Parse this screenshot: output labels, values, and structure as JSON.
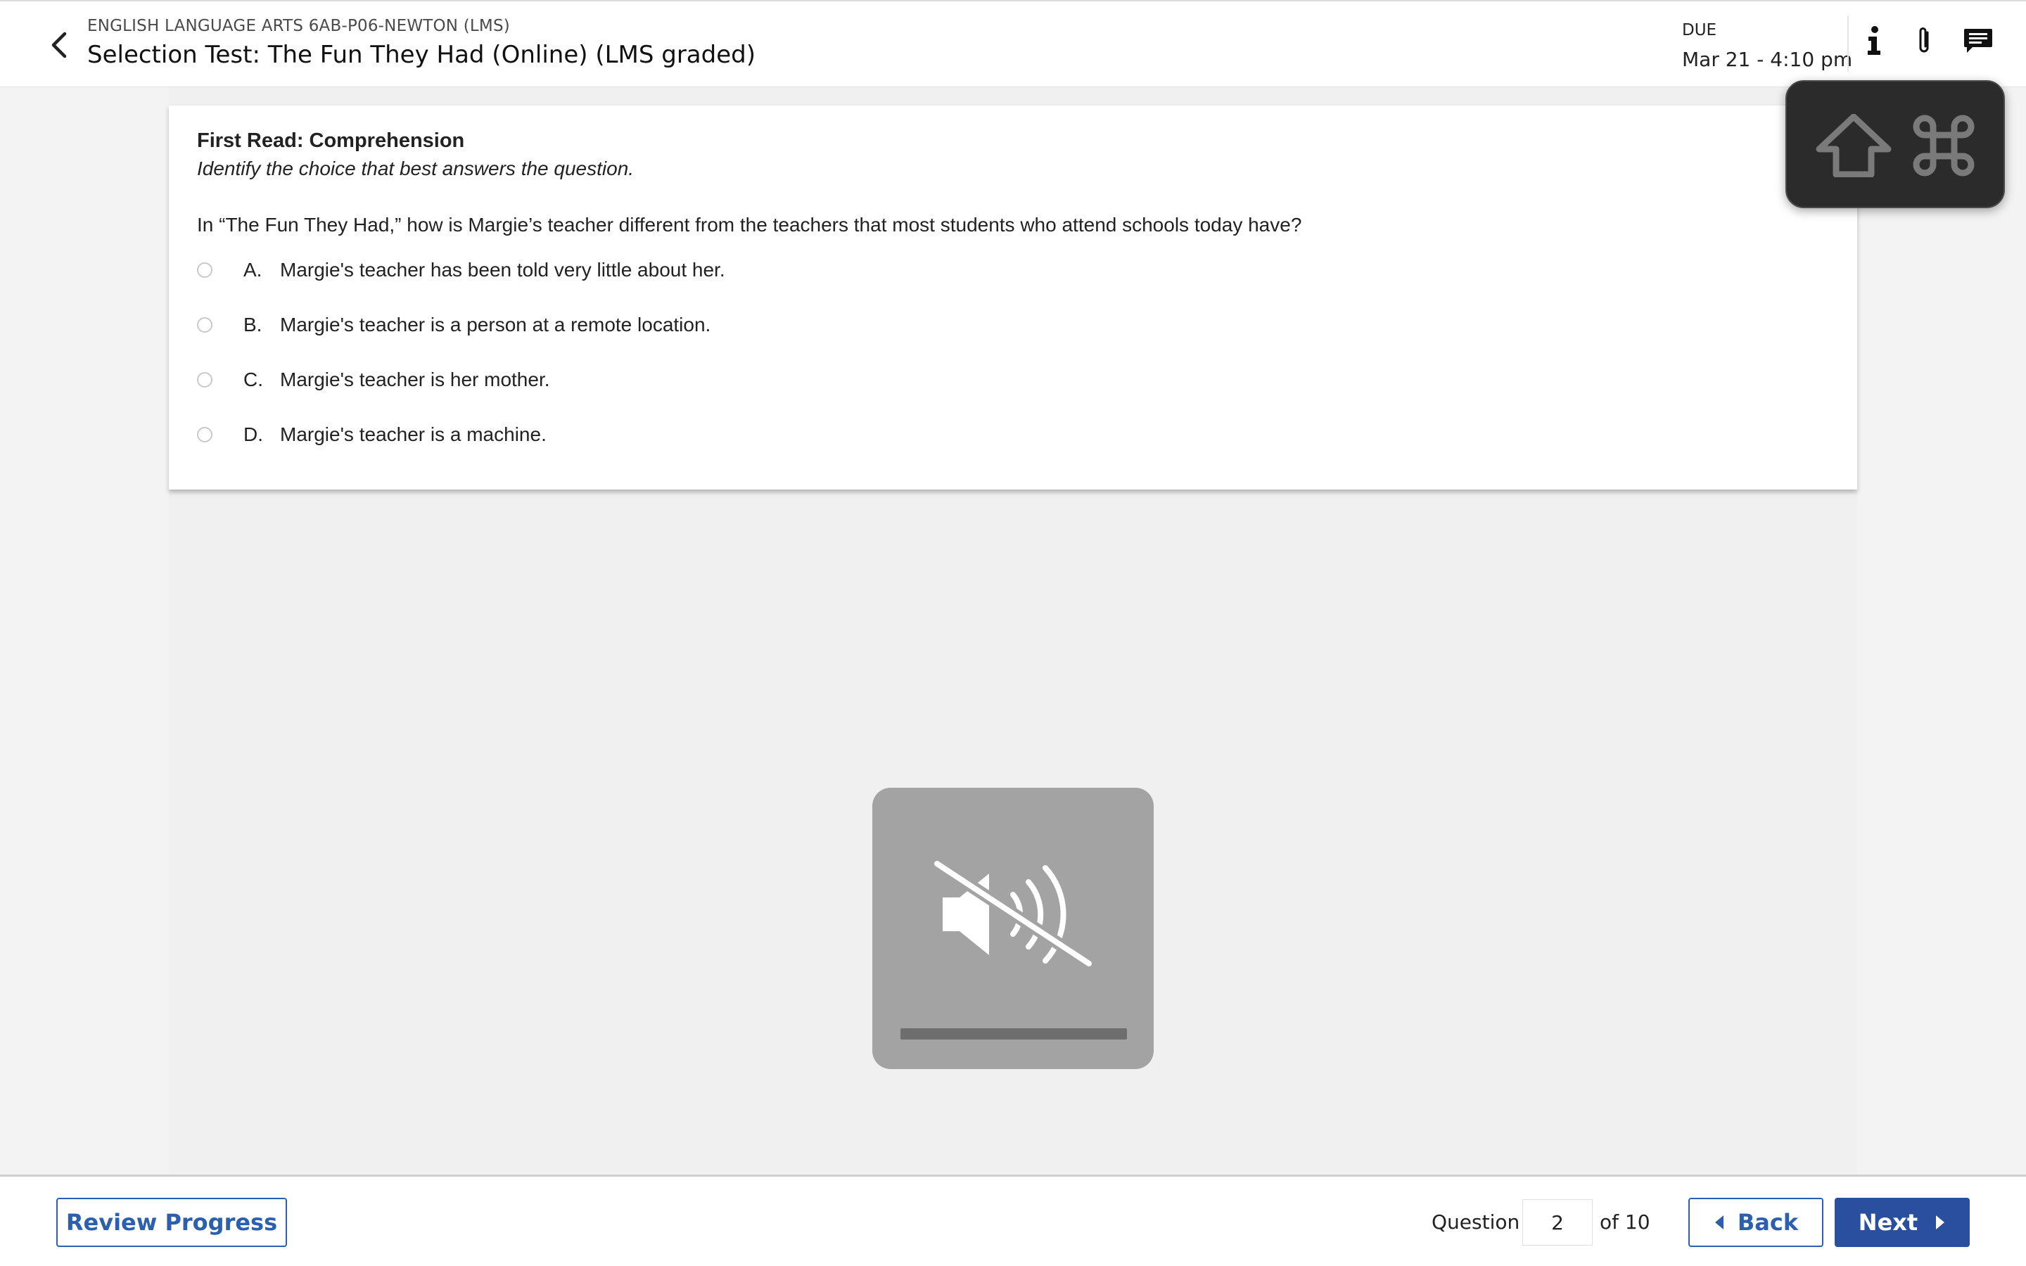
{
  "header": {
    "course": "ENGLISH LANGUAGE ARTS 6AB-P06-NEWTON (LMS)",
    "title": "Selection Test: The Fun They Had (Online) (LMS graded)",
    "due_label": "DUE",
    "due_date": "Mar 21 - 4:10 pm",
    "icons": [
      "back-chevron-icon",
      "info-icon",
      "paperclip-icon",
      "comment-icon"
    ]
  },
  "question": {
    "section_heading": "First Read: Comprehension",
    "instruction": "Identify the choice that best answers the question.",
    "prompt": "In “The Fun They Had,” how is Margie’s teacher different from the teachers that most students who attend schools today have?",
    "options": [
      {
        "letter": "A.",
        "text": "Margie's teacher has been told very little about her."
      },
      {
        "letter": "B.",
        "text": "Margie's teacher is a person at a remote location."
      },
      {
        "letter": "C.",
        "text": "Margie's teacher is her mother."
      },
      {
        "letter": "D.",
        "text": "Margie's teacher is a machine."
      }
    ]
  },
  "overlays": {
    "keyboard_hint_icons": [
      "shift-key-icon",
      "command-key-icon"
    ],
    "volume_icon": "speaker-muted-icon"
  },
  "footer": {
    "review_label": "Review Progress",
    "question_label": "Question",
    "current_question": "2",
    "of_total": "of 10",
    "back_label": "Back",
    "next_label": "Next"
  },
  "colors": {
    "accent": "#2a4f9e",
    "outline_button": "#2c5fad",
    "overlay_dark": "#2b2b2b",
    "overlay_gray": "#a3a3a3"
  }
}
